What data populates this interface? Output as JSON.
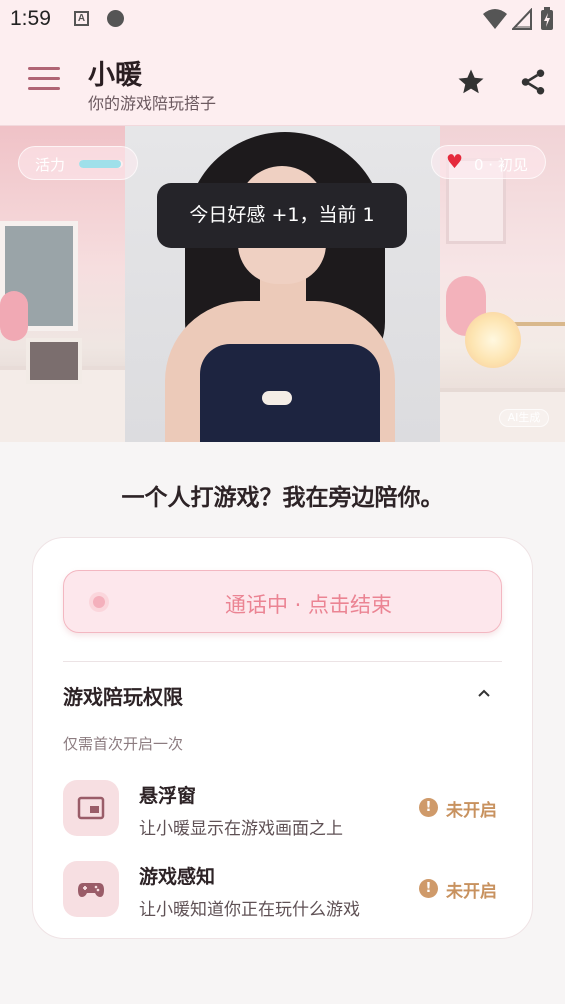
{
  "status_bar": {
    "time": "1:59",
    "notif_icon_letter": "A"
  },
  "app_bar": {
    "title": "小暖",
    "subtitle": "你的游戏陪玩搭子",
    "icons": [
      "menu-icon",
      "star-icon",
      "share-icon"
    ]
  },
  "hero": {
    "vigor_label": "活力",
    "vigor_level": 0.95,
    "affection_value": "0 · 初见",
    "toast": "今日好感 +1，当前 1",
    "ai_tag": "AI生成"
  },
  "headline": "一个人打游戏？我在旁边陪你。",
  "call_button": {
    "label": "通话中 · 点击结束"
  },
  "permissions": {
    "title": "游戏陪玩权限",
    "hint": "仅需首次开启一次",
    "items": [
      {
        "name": "悬浮窗",
        "desc": "让小暖显示在游戏画面之上",
        "status": "未开启",
        "icon": "floating-window-icon"
      },
      {
        "name": "游戏感知",
        "desc": "让小暖知道你正在玩什么游戏",
        "status": "未开启",
        "icon": "gamepad-icon"
      }
    ]
  },
  "colors": {
    "accent_pink": "#eb8493",
    "status_orange": "#c8925f",
    "app_bar_bg": "#fdeef0",
    "icon_tile_bg": "#f7dfe2"
  }
}
